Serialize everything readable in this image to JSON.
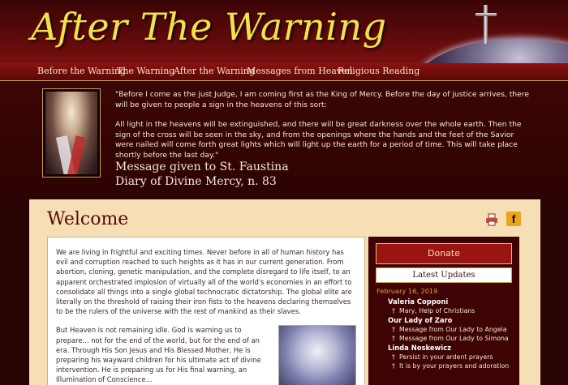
{
  "site": {
    "title": "After The Warning"
  },
  "nav": {
    "items": [
      {
        "label": "Before the Warning"
      },
      {
        "label": "The Warning"
      },
      {
        "label": "After the Warning"
      },
      {
        "label": "Messages from Heaven"
      },
      {
        "label": "Religious Reading"
      }
    ]
  },
  "quote": {
    "paragraph1": "\"Before I come as the just Judge, I am coming first as the King of Mercy. Before the day of justice arrives, there will be given to people a sign in the heavens of this sort:",
    "paragraph2": "All light in the heavens will be extinguished, and there will be great darkness over the whole earth. Then the sign of the cross will be seen in the sky, and from the openings where the hands and the feet of the Savior were nailed will come forth great lights which will light up the earth for a period of time. This will take place shortly before the last day.\"",
    "source_line1": "Message given to St. Faustina",
    "source_line2": "Diary of Divine Mercy, n. 83"
  },
  "main": {
    "heading": "Welcome",
    "paragraph1": "We are living in frightful and exciting times. Never before in all of human history has evil and corruption reached to such heights as it has in our current generation. From abortion, cloning, genetic manipulation, and the complete disregard to life itself, to an apparent orchestrated implosion of virtually all of the world's economies in an effort to consolidate all things into a single global technocratic dictatorship. The global elite are literally on the threshold of raising their iron fists to the heavens declaring themselves to be the rulers of the universe with the rest of mankind as their slaves.",
    "paragraph2": "But Heaven is not remaining idle. God is warning us to prepare... not for the end of the world, but for the end of an era. Through His Son Jesus and His Blessed Mother, He is preparing his wayward children for his ultimate act of divine intervention. He is preparing us for His final warning, an Illumination of Conscience..."
  },
  "sidebar": {
    "donate_label": "Donate",
    "latest_label": "Latest Updates",
    "date": "February 16, 2019",
    "groups": [
      {
        "author": "Valeria Copponi",
        "items": [
          "Mary, Help of Christians"
        ]
      },
      {
        "author": "Our Lady of Zaro",
        "items": [
          "Message from Our Lady to Angela",
          "Message from Our Lady to Simona"
        ]
      },
      {
        "author": "Linda Noskewicz",
        "items": [
          "Persist in your ardent prayers",
          "It is by your prayers and adoration"
        ]
      }
    ]
  },
  "icons": {
    "print": "print-icon",
    "facebook": "facebook-icon"
  },
  "colors": {
    "title_yellow": "#f2e14a",
    "maroon": "#5a0a0a",
    "panel": "#f6dfb4",
    "date_orange": "#e8a13a"
  }
}
